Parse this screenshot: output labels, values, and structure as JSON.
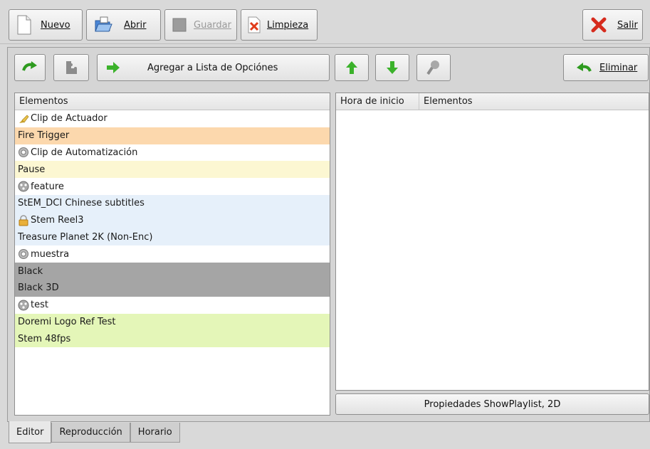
{
  "toolbar": {
    "nuevo": "Nuevo",
    "abrir": "Abrir",
    "guardar": "Guardar",
    "limpieza": "Limpieza",
    "salir": "Salir"
  },
  "editor": {
    "add_to_list": "Agregar a Lista de Opciónes",
    "eliminar": "Eliminar",
    "left_header": "Elementos",
    "right_headers": [
      "Hora de inicio",
      "Elementos"
    ],
    "properties": "Propiedades ShowPlaylist, 2D",
    "items": [
      {
        "label": "Clip de Actuador",
        "icon": "actuator-icon",
        "bg": "#ffffff"
      },
      {
        "label": "Fire Trigger",
        "icon": "",
        "bg": "#fcd8ad"
      },
      {
        "label": "Clip de Automatización",
        "icon": "gear-icon",
        "bg": "#ffffff"
      },
      {
        "label": "Pause",
        "icon": "",
        "bg": "#fcf7d2"
      },
      {
        "label": "feature",
        "icon": "film-reel-icon",
        "bg": "#ffffff"
      },
      {
        "label": "StEM_DCI Chinese subtitles",
        "icon": "",
        "bg": "#e6f0fa"
      },
      {
        "label": "Stem Reel3",
        "icon": "lock-icon",
        "bg": "#e6f0fa"
      },
      {
        "label": "Treasure Planet 2K (Non-Enc)",
        "icon": "",
        "bg": "#e6f0fa"
      },
      {
        "label": "muestra",
        "icon": "gear-icon",
        "bg": "#ffffff"
      },
      {
        "label": "Black",
        "icon": "",
        "bg": "#a5a5a5"
      },
      {
        "label": "Black 3D",
        "icon": "",
        "bg": "#a5a5a5"
      },
      {
        "label": "test",
        "icon": "film-reel-icon",
        "bg": "#ffffff"
      },
      {
        "label": "Doremi Logo Ref Test",
        "icon": "",
        "bg": "#e4f6b8"
      },
      {
        "label": "Stem 48fps",
        "icon": "",
        "bg": "#e4f6b8"
      }
    ]
  },
  "tabs": [
    "Editor",
    "Reproducción",
    "Horario"
  ]
}
